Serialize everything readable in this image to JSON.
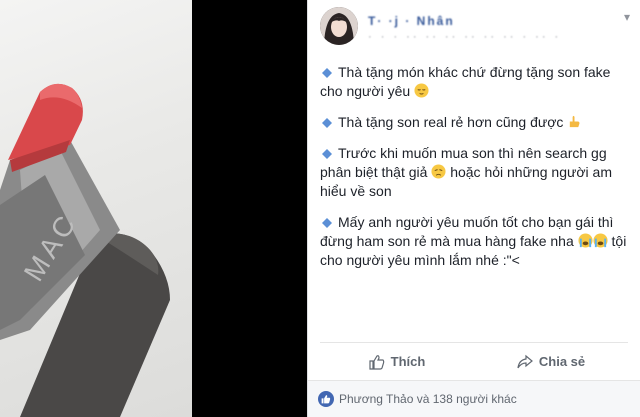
{
  "post": {
    "author": "T· ·j · Nhân",
    "meta": "· · · ·· ·· ·· ·· ·· ·· · ·· ·",
    "paragraphs": [
      {
        "text": "Thà tặng món khác chứ đừng tặng son fake cho người yêu",
        "emoji": "relieved-face"
      },
      {
        "text": "Thà tặng son real rẻ hơn cũng được",
        "emoji": "pointing-hand"
      },
      {
        "text_before": "Trước khi muốn mua son thì nên search gg phân biệt thật giả",
        "emoji": "disappointed-face",
        "text_after": "hoặc hỏi những người am hiểu về son"
      },
      {
        "text_before": "Mấy anh người yêu muốn tốt cho bạn gái thì đừng ham son rẻ mà mua hàng fake nha",
        "emoji": "crying-faces",
        "text_after": "tội cho người yêu mình lắm nhé :\"<"
      }
    ]
  },
  "actions": {
    "like_label": "Thích",
    "share_label": "Chia sẻ"
  },
  "reactions": {
    "summary": "Phương Thảo và 138 người khác"
  },
  "colors": {
    "link": "#365899",
    "bullet": "#5b8fd6",
    "like": "#4267b2",
    "lipstick": "#d9484b"
  }
}
